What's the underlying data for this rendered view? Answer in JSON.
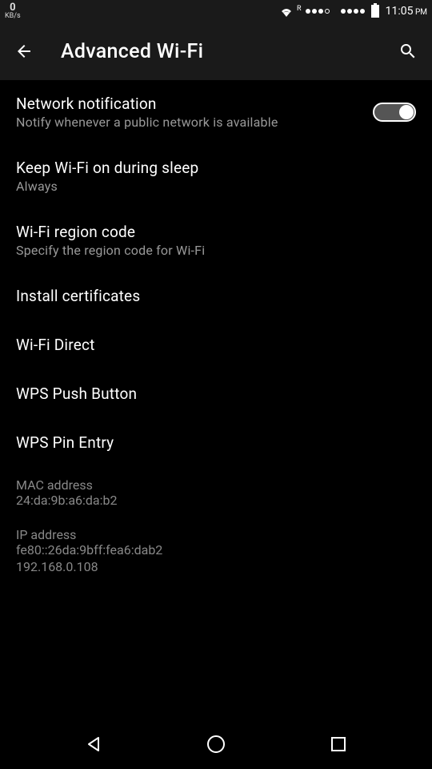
{
  "statusBar": {
    "speed": "0",
    "speedUnit": "KB/s",
    "roaming": "R",
    "time": "11:05",
    "ampm": "PM"
  },
  "header": {
    "title": "Advanced Wi-Fi"
  },
  "settings": {
    "networkNotification": {
      "title": "Network notification",
      "subtitle": "Notify whenever a public network is available"
    },
    "keepWifiSleep": {
      "title": "Keep Wi-Fi on during sleep",
      "subtitle": "Always"
    },
    "regionCode": {
      "title": "Wi-Fi region code",
      "subtitle": "Specify the region code for Wi-Fi"
    },
    "installCerts": {
      "title": "Install certificates"
    },
    "wifiDirect": {
      "title": "Wi-Fi Direct"
    },
    "wpsPush": {
      "title": "WPS Push Button"
    },
    "wpsPin": {
      "title": "WPS Pin Entry"
    }
  },
  "info": {
    "macLabel": "MAC address",
    "macValue": "24:da:9b:a6:da:b2",
    "ipLabel": "IP address",
    "ipValue1": "fe80::26da:9bff:fea6:dab2",
    "ipValue2": "192.168.0.108"
  }
}
